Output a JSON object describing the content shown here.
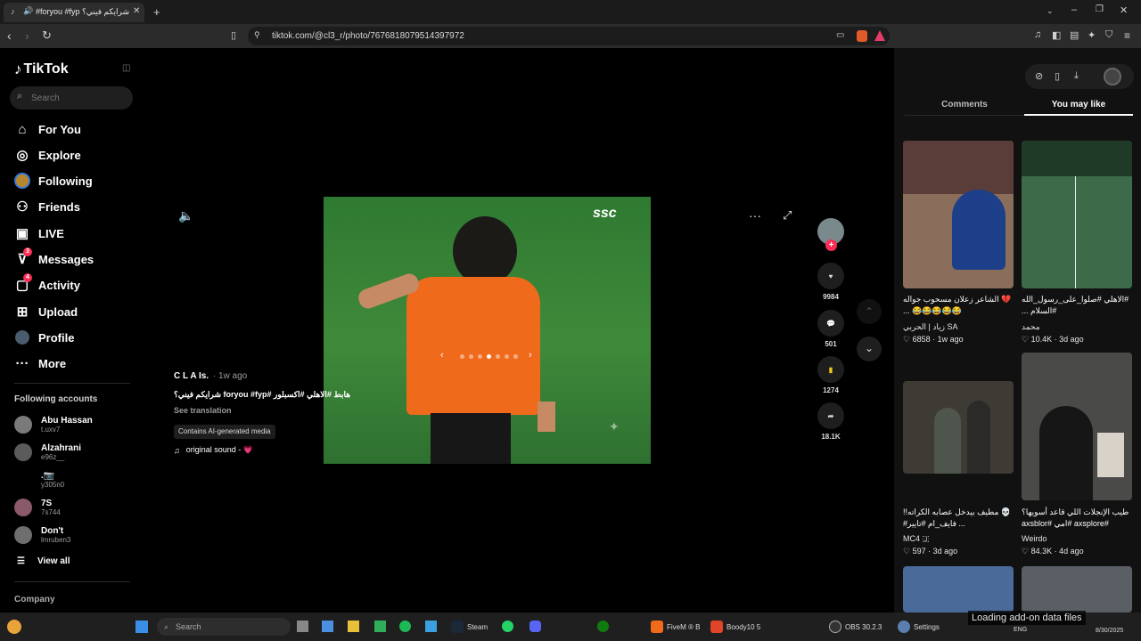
{
  "browser": {
    "tab_title": "#foryou #fyp شرايكم فيني؟",
    "url": "tiktok.com/@cl3_r/photo/7676818079514397972"
  },
  "tiktok": {
    "logo": "TikTok",
    "search_placeholder": "Search",
    "nav": [
      {
        "label": "For You",
        "icon": "home-icon"
      },
      {
        "label": "Explore",
        "icon": "compass-icon"
      },
      {
        "label": "Following",
        "icon": "following-avatar-icon"
      },
      {
        "label": "Friends",
        "icon": "friends-icon"
      },
      {
        "label": "LIVE",
        "icon": "live-icon"
      },
      {
        "label": "Messages",
        "icon": "messages-icon",
        "badge": "3"
      },
      {
        "label": "Activity",
        "icon": "activity-icon",
        "badge": "4"
      },
      {
        "label": "Upload",
        "icon": "upload-icon"
      },
      {
        "label": "Profile",
        "icon": "profile-avatar-icon"
      },
      {
        "label": "More",
        "icon": "more-dots-icon"
      }
    ],
    "following_heading": "Following accounts",
    "accounts": [
      {
        "name": "Abu Hassan",
        "handle": "t.uxv7"
      },
      {
        "name": "Alzahrani",
        "handle": "e96z__"
      },
      {
        "name": ".📷",
        "handle": "y305n0"
      },
      {
        "name": "7S",
        "handle": "7s744"
      },
      {
        "name": "Don't",
        "handle": "lmruben3"
      }
    ],
    "view_all": "View all",
    "company": "Company"
  },
  "post": {
    "author": "C L A Is.",
    "time": "· 1w ago",
    "caption": "هابط #الاهلي #اكسبلور #foryou #fyp شرايكم فيني؟",
    "see_translation": "See translation",
    "ai_label": "Contains AI-generated media",
    "sound": "original sound - 💗",
    "watermark": "ssc",
    "slide_count": 7,
    "active_slide": 4,
    "likes": "9984",
    "comments": "501",
    "saves": "1274",
    "shares": "18.1K"
  },
  "panel": {
    "tabs": [
      "Comments",
      "You may like"
    ],
    "active_tab": "You may like",
    "cards": [
      {
        "title": "💔 الشاعر زعلان مسحوب جواله 😂😂😂😂😂 ...",
        "author": "زياد | الحربي SA",
        "likes": "6858",
        "time": "1w ago",
        "bg": "#8a6d5a"
      },
      {
        "title": "#الاهلي #صلوا_على_رسول_الله #السلام ...",
        "author": "محمد",
        "likes": "10.4K",
        "time": "3d ago",
        "bg": "#3d6b4a"
      },
      {
        "title": "💀 مطيف بيدخل عصابه الكراته!! ‪#فايف_ام #تايير ...‬",
        "author": "MC4 🇯",
        "likes": "597",
        "time": "3d ago",
        "bg": "#3e3a34"
      },
      {
        "title": "طيب الإنجلات اللي قاعد أسويها؟ #axsplore #امي #axsblor",
        "author": "Weirdo",
        "likes": "84.3K",
        "time": "4d ago",
        "bg": "#4a4a48"
      }
    ]
  },
  "taskbar": {
    "search": "Search",
    "apps": [
      "Steam",
      "FiveM ® B",
      "Boody10 5",
      "OBS 30.2.3",
      "Settings"
    ],
    "notification": "Loading add-on data files",
    "lang": "ENG",
    "date": "8/30/2025"
  }
}
